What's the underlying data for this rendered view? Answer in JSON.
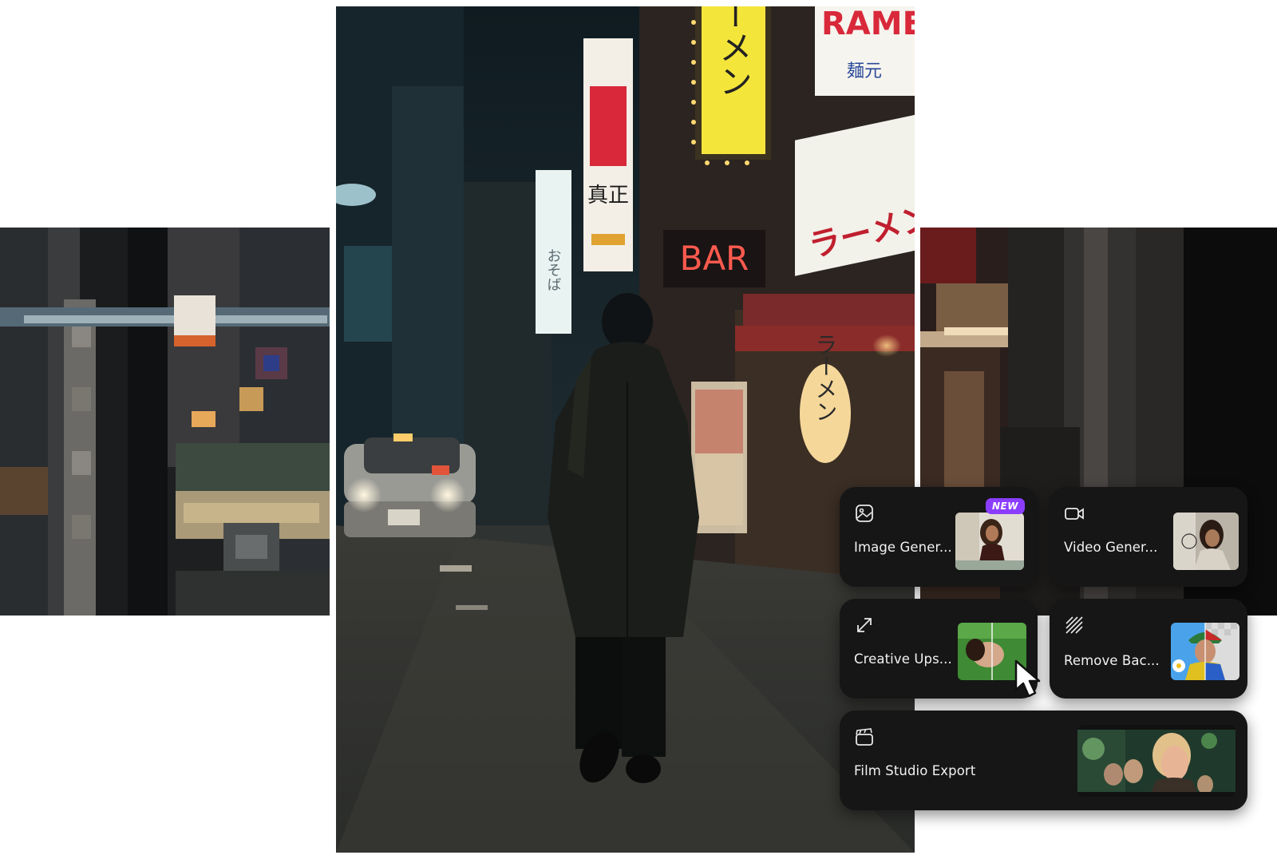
{
  "photo": {
    "signs": {
      "ramen_en": "RAMEN",
      "ramen_kanji": "麺元",
      "bar": "BAR",
      "yellow_vertical": "ラーメン",
      "white_big": "ラーメン部屋",
      "lantern": "ラーメン",
      "tall_sign_kanji": "真正",
      "small_vertical": "おそば"
    }
  },
  "cards": [
    {
      "label": "Image Gener...",
      "icon": "image-icon",
      "badge": "NEW"
    },
    {
      "label": "Video Gener...",
      "icon": "video-camera-icon"
    },
    {
      "label": "Creative Ups...",
      "icon": "expand-arrows-icon"
    },
    {
      "label": "Remove Bac...",
      "icon": "diagonal-lines-icon"
    },
    {
      "label": "Film Studio Export",
      "icon": "clapperboard-icon"
    }
  ],
  "colors": {
    "card_bg": "#161616",
    "badge": "#8b3dff",
    "bar_sign": "#ff5a4e",
    "ramen_red": "#d8283a",
    "neon_yellow": "#f4e53a"
  }
}
